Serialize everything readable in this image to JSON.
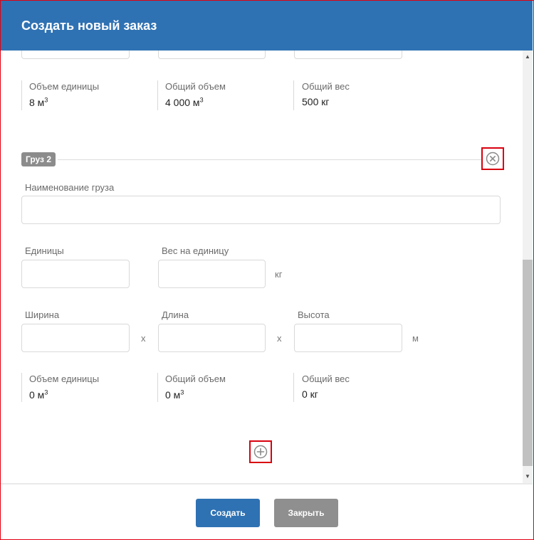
{
  "header": {
    "title": "Создать новый заказ"
  },
  "cargo1_summary": {
    "unit_volume_label": "Объем единицы",
    "unit_volume_value": "8 м",
    "total_volume_label": "Общий объем",
    "total_volume_value": "4 000 м",
    "total_weight_label": "Общий вес",
    "total_weight_value": "500 кг",
    "cube_sup": "3"
  },
  "cargo2": {
    "badge": "Груз 2",
    "name_label": "Наименование груза",
    "name_value": "",
    "units_label": "Единицы",
    "units_value": "",
    "weight_per_unit_label": "Вес на единицу",
    "weight_per_unit_value": "",
    "weight_unit": "кг",
    "width_label": "Ширина",
    "length_label": "Длина",
    "height_label": "Высота",
    "width_value": "",
    "length_value": "",
    "height_value": "",
    "times_sign": "x",
    "dimension_unit": "м",
    "unit_volume_label": "Объем единицы",
    "unit_volume_value": "0 м",
    "total_volume_label": "Общий объем",
    "total_volume_value": "0 м",
    "total_weight_label": "Общий вес",
    "total_weight_value": "0 кг",
    "cube_sup": "3"
  },
  "footer": {
    "create_label": "Создать",
    "close_label": "Закрыть"
  },
  "colors": {
    "header_bg": "#2f72b3",
    "primary_button": "#2f72b3",
    "secondary_button": "#8f8f8f",
    "highlight_border": "#d9000f"
  }
}
